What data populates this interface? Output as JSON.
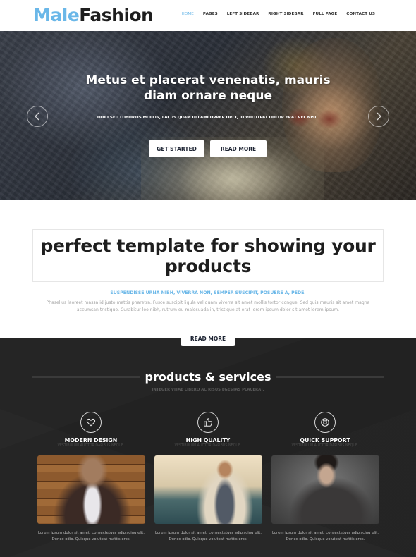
{
  "header": {
    "logo_part1": "Male",
    "logo_part2": "Fashion",
    "nav": [
      {
        "label": "HOME",
        "active": true
      },
      {
        "label": "PAGES",
        "active": false
      },
      {
        "label": "LEFT SIDEBAR",
        "active": false
      },
      {
        "label": "RIGHT SIDEBAR",
        "active": false
      },
      {
        "label": "FULL PAGE",
        "active": false
      },
      {
        "label": "CONTACT US",
        "active": false
      }
    ]
  },
  "hero": {
    "title": "Metus et placerat venenatis, mauris diam ornare neque",
    "subtitle": "ODIO SED LOBORTIS MOLLIS, LACUS QUAM ULLAMCORPER ORCI, ID VOLUTPAT DOLOR ERAT VEL NISL.",
    "primary_button": "GET STARTED",
    "secondary_button": "READ MORE",
    "prev_icon": "chevron-left-icon",
    "next_icon": "chevron-right-icon"
  },
  "intro": {
    "title": "perfect template for showing your products",
    "tagline": "SUSPENDISSE URNA NIBH, VIVERRA NON, SEMPER SUSCIPIT, POSUERE A, PEDE.",
    "text": "Phasellus laoreet massa id justo mattis pharetra. Fusce suscipit ligula vel quam viverra sit amet mollis tortor congue. Sed quis mauris sit amet magna accumsan tristique. Curabitur leo nibh, rutrum eu malesuada in, tristique at erat lorem ipsum dolor sit amet lorem ipsum.",
    "button": "READ MORE"
  },
  "services": {
    "title": "products & services",
    "subtitle": "INTEGER VITAE LIBERO AC RISUS EGESTAS PLACERAT.",
    "features": [
      {
        "icon": "heart-icon",
        "title": "MODERN DESIGN",
        "subtitle": "VESTIBULUM AUCTOR DAPIBUS NEQUE."
      },
      {
        "icon": "thumbs-up-icon",
        "title": "HIGH QUALITY",
        "subtitle": "VESTIBULUM AUCTOR DAPIBUS NEQUE."
      },
      {
        "icon": "lifebuoy-icon",
        "title": "QUICK SUPPORT",
        "subtitle": "VESTIBULUM AUCTOR DAPIBUS NEQUE."
      }
    ],
    "products": [
      {
        "caption": "Lorem ipsum dolor sit amet, consectetuer adipiscing elit. Donec odio. Quisque volutpat mattis eros."
      },
      {
        "caption": "Lorem ipsum dolor sit amet, consectetuer adipiscing elit. Donec odio. Quisque volutpat mattis eros."
      },
      {
        "caption": "Lorem ipsum dolor sit amet, consectetuer adipiscing elit. Donec odio. Quisque volutpat mattis eros."
      }
    ]
  },
  "colors": {
    "accent": "#6ab7e8",
    "dark_bg": "#222222",
    "heading": "#1e1e1e"
  }
}
